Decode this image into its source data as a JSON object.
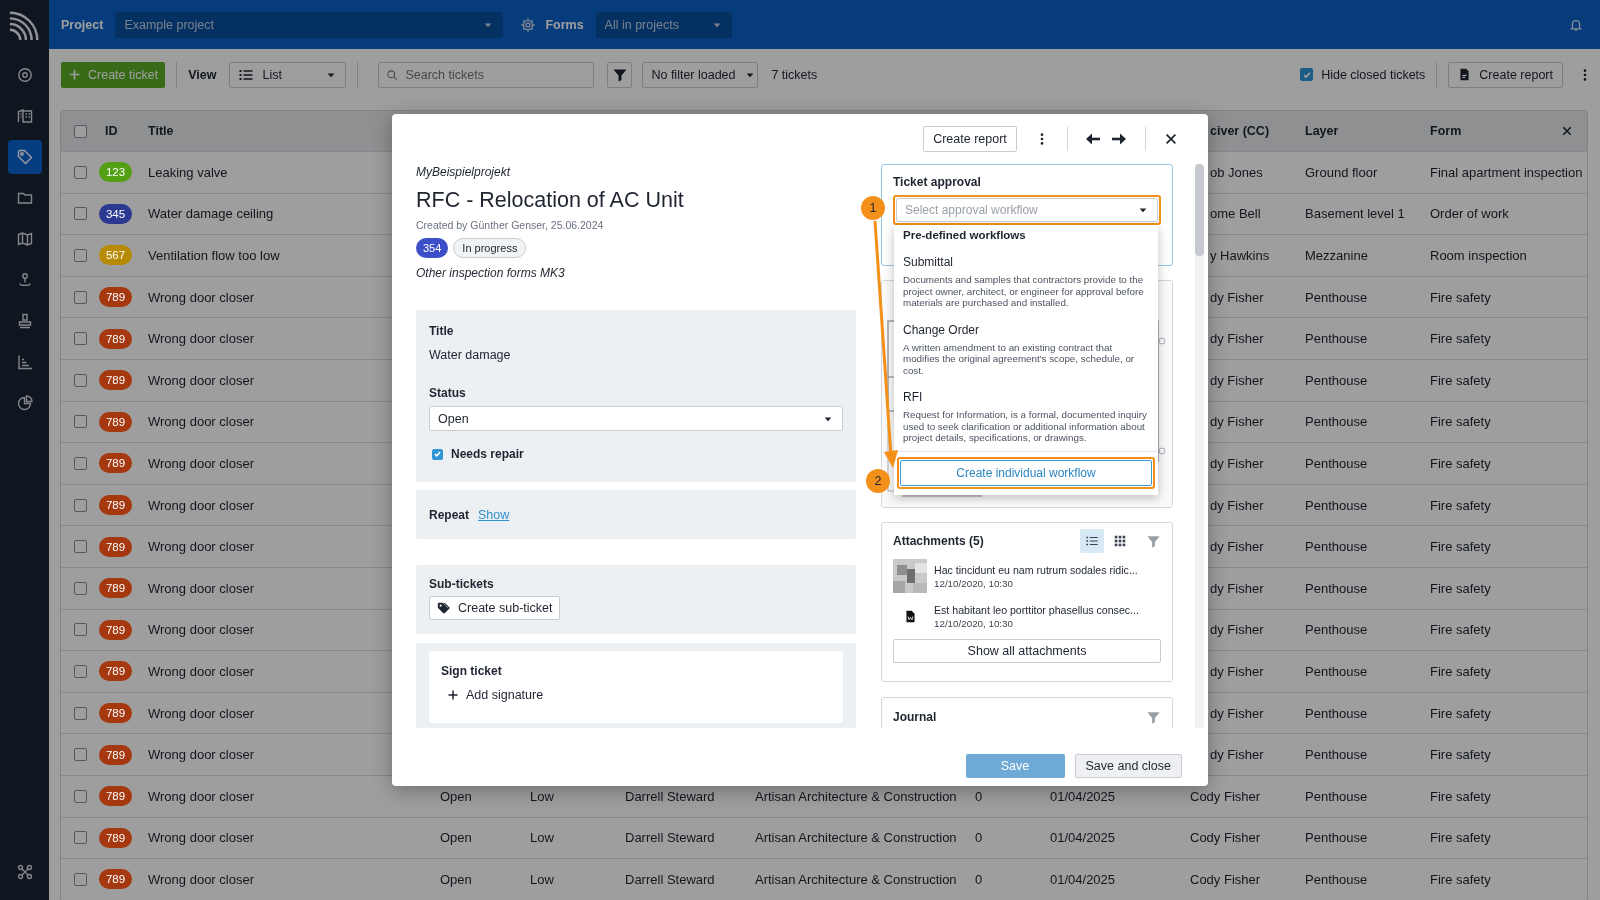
{
  "sidebar": {
    "items": [
      {
        "kind": "info",
        "selected": false
      },
      {
        "kind": "building",
        "selected": false
      },
      {
        "kind": "tag",
        "selected": true
      },
      {
        "kind": "folder",
        "selected": false
      },
      {
        "kind": "map",
        "selected": false
      },
      {
        "kind": "pin",
        "selected": false
      },
      {
        "kind": "stamp",
        "selected": false
      },
      {
        "kind": "chart",
        "selected": false
      },
      {
        "kind": "pie",
        "selected": false
      },
      {
        "kind": "apps",
        "selected": false
      }
    ]
  },
  "top_bar": {
    "project_label": "Project",
    "project": "Example project",
    "forms_label": "Forms",
    "forms": "All in projects"
  },
  "toolbar": {
    "create_button": "Create ticket",
    "view_label": "View",
    "view": "List",
    "search": {
      "placeholder": "Search tickets"
    },
    "filter": "No filter loaded",
    "count": "7 tickets",
    "hide_closed": {
      "label": "Hide closed tickets",
      "checked": true
    },
    "report_button": "Create report"
  },
  "table": {
    "select_all": {
      "checked": false
    },
    "columns": [
      "ID",
      "Title",
      "civer (CC)",
      "Layer",
      "Form"
    ],
    "rows": [
      {
        "checked": false,
        "id": "123",
        "color": "#54a015",
        "title": "Leaking valve",
        "receiver": "ob Jones",
        "layer": "Ground floor",
        "form": "Final apartment inspection"
      },
      {
        "checked": false,
        "id": "345",
        "color": "#2b3a90",
        "title": "Water damage ceiling",
        "receiver": "ome Bell",
        "layer": "Basement level 1",
        "form": "Order of work"
      },
      {
        "checked": false,
        "id": "567",
        "color": "#b88b06",
        "title": "Ventilation flow too low",
        "receiver": "y Hawkins",
        "layer": "Mezzanine",
        "form": "Room inspection"
      },
      {
        "checked": false,
        "id": "789",
        "color": "#a5380f",
        "title": "Wrong door closer",
        "receiver": "dy Fisher",
        "layer": "Penthouse",
        "form": "Fire safety"
      },
      {
        "checked": false,
        "id": "789",
        "color": "#a5380f",
        "title": "Wrong door closer",
        "receiver": "dy Fisher",
        "layer": "Penthouse",
        "form": "Fire safety"
      },
      {
        "checked": false,
        "id": "789",
        "color": "#a5380f",
        "title": "Wrong door closer",
        "receiver": "dy Fisher",
        "layer": "Penthouse",
        "form": "Fire safety"
      },
      {
        "checked": false,
        "id": "789",
        "color": "#a5380f",
        "title": "Wrong door closer",
        "receiver": "dy Fisher",
        "layer": "Penthouse",
        "form": "Fire safety"
      },
      {
        "checked": false,
        "id": "789",
        "color": "#a5380f",
        "title": "Wrong door closer",
        "receiver": "dy Fisher",
        "layer": "Penthouse",
        "form": "Fire safety"
      },
      {
        "checked": false,
        "id": "789",
        "color": "#a5380f",
        "title": "Wrong door closer",
        "receiver": "dy Fisher",
        "layer": "Penthouse",
        "form": "Fire safety"
      },
      {
        "checked": false,
        "id": "789",
        "color": "#a5380f",
        "title": "Wrong door closer",
        "receiver": "dy Fisher",
        "layer": "Penthouse",
        "form": "Fire safety"
      },
      {
        "checked": false,
        "id": "789",
        "color": "#a5380f",
        "title": "Wrong door closer",
        "receiver": "dy Fisher",
        "layer": "Penthouse",
        "form": "Fire safety"
      },
      {
        "checked": false,
        "id": "789",
        "color": "#a5380f",
        "title": "Wrong door closer",
        "receiver": "dy Fisher",
        "layer": "Penthouse",
        "form": "Fire safety"
      },
      {
        "checked": false,
        "id": "789",
        "color": "#a5380f",
        "title": "Wrong door closer",
        "receiver": "dy Fisher",
        "layer": "Penthouse",
        "form": "Fire safety"
      },
      {
        "checked": false,
        "id": "789",
        "color": "#a5380f",
        "title": "Wrong door closer",
        "receiver": "dy Fisher",
        "layer": "Penthouse",
        "form": "Fire safety"
      },
      {
        "checked": false,
        "id": "789",
        "color": "#a5380f",
        "title": "Wrong door closer",
        "receiver": "dy Fisher",
        "layer": "Penthouse",
        "form": "Fire safety"
      },
      {
        "checked": false,
        "id": "789",
        "color": "#a5380f",
        "title": "Wrong door closer",
        "status": "Open",
        "priority": "Low",
        "assignee": "Darrell Steward",
        "company": "Artisan Architecture & Construction",
        "count": "0",
        "date": "01/04/2025",
        "receiver": "Cody Fisher",
        "layer": "Penthouse",
        "form": "Fire safety"
      },
      {
        "checked": false,
        "id": "789",
        "color": "#a5380f",
        "title": "Wrong door closer",
        "status": "Open",
        "priority": "Low",
        "assignee": "Darrell Steward",
        "company": "Artisan Architecture & Construction",
        "count": "0",
        "date": "01/04/2025",
        "receiver": "Cody Fisher",
        "layer": "Penthouse",
        "form": "Fire safety"
      },
      {
        "checked": false,
        "id": "789",
        "color": "#a5380f",
        "title": "Wrong door closer",
        "status": "Open",
        "priority": "Low",
        "assignee": "Darrell Steward",
        "company": "Artisan Architecture & Construction",
        "count": "0",
        "date": "01/04/2025",
        "receiver": "Cody Fisher",
        "layer": "Penthouse",
        "form": "Fire safety"
      }
    ]
  },
  "ticket_modal": {
    "report_button": "Create report",
    "project": "MyBeispielprojekt",
    "title": "RFC - Relocation of AC Unit",
    "created": "Created by Günther Genser, 25.06.2024",
    "number": "354",
    "state": "In progress",
    "form": "Other inspection forms MK3",
    "fields": {
      "title_label": "Title",
      "title_value": "Water damage",
      "status_label": "Status",
      "status_value": "Open",
      "needs_repair": {
        "label": "Needs repair",
        "checked": true
      }
    },
    "repeat": {
      "label": "Repeat",
      "link": "Show"
    },
    "sub_tickets": {
      "label": "Sub-tickets",
      "button": "Create sub-ticket"
    },
    "sign": {
      "label": "Sign ticket",
      "button": "Add signature"
    },
    "approval": {
      "label": "Ticket approval",
      "select": {
        "placeholder": "Select approval workflow"
      },
      "menu": {
        "heading": "Pre-defined workflows",
        "options": [
          {
            "name": "Submittal",
            "description": "Documents and samples that contractors provide to the project owner, architect, or engineer for approval before materials are purchased and installed."
          },
          {
            "name": "Change Order",
            "description": "A written amendment to an existing contract that modifies the original agreement's scope, schedule, or cost."
          },
          {
            "name": "RFI",
            "description": "Request for Information, is a formal, documented inquiry used to seek clarification or additional information about project details, specifications, or drawings."
          }
        ],
        "create_button": "Create individual workflow"
      }
    },
    "callouts": [
      {
        "number": "1"
      },
      {
        "number": "2"
      }
    ],
    "attachments": {
      "title": "Attachments (5)",
      "views": [
        {
          "kind": "list",
          "selected": true
        },
        {
          "kind": "grid",
          "selected": false
        }
      ],
      "items": [
        {
          "name": "Hac tincidunt eu nam rutrum sodales ridic...",
          "date": "12/10/2020, 10:30"
        },
        {
          "kind": "document",
          "name": "Est habitant leo porttitor phasellus consec...",
          "date": "12/10/2020, 10:30"
        }
      ],
      "button": "Show all attachments"
    },
    "journal": {
      "title": "Journal"
    },
    "footer": {
      "save": {
        "label": "Save",
        "disabled": true
      },
      "save_close": "Save and close"
    }
  }
}
